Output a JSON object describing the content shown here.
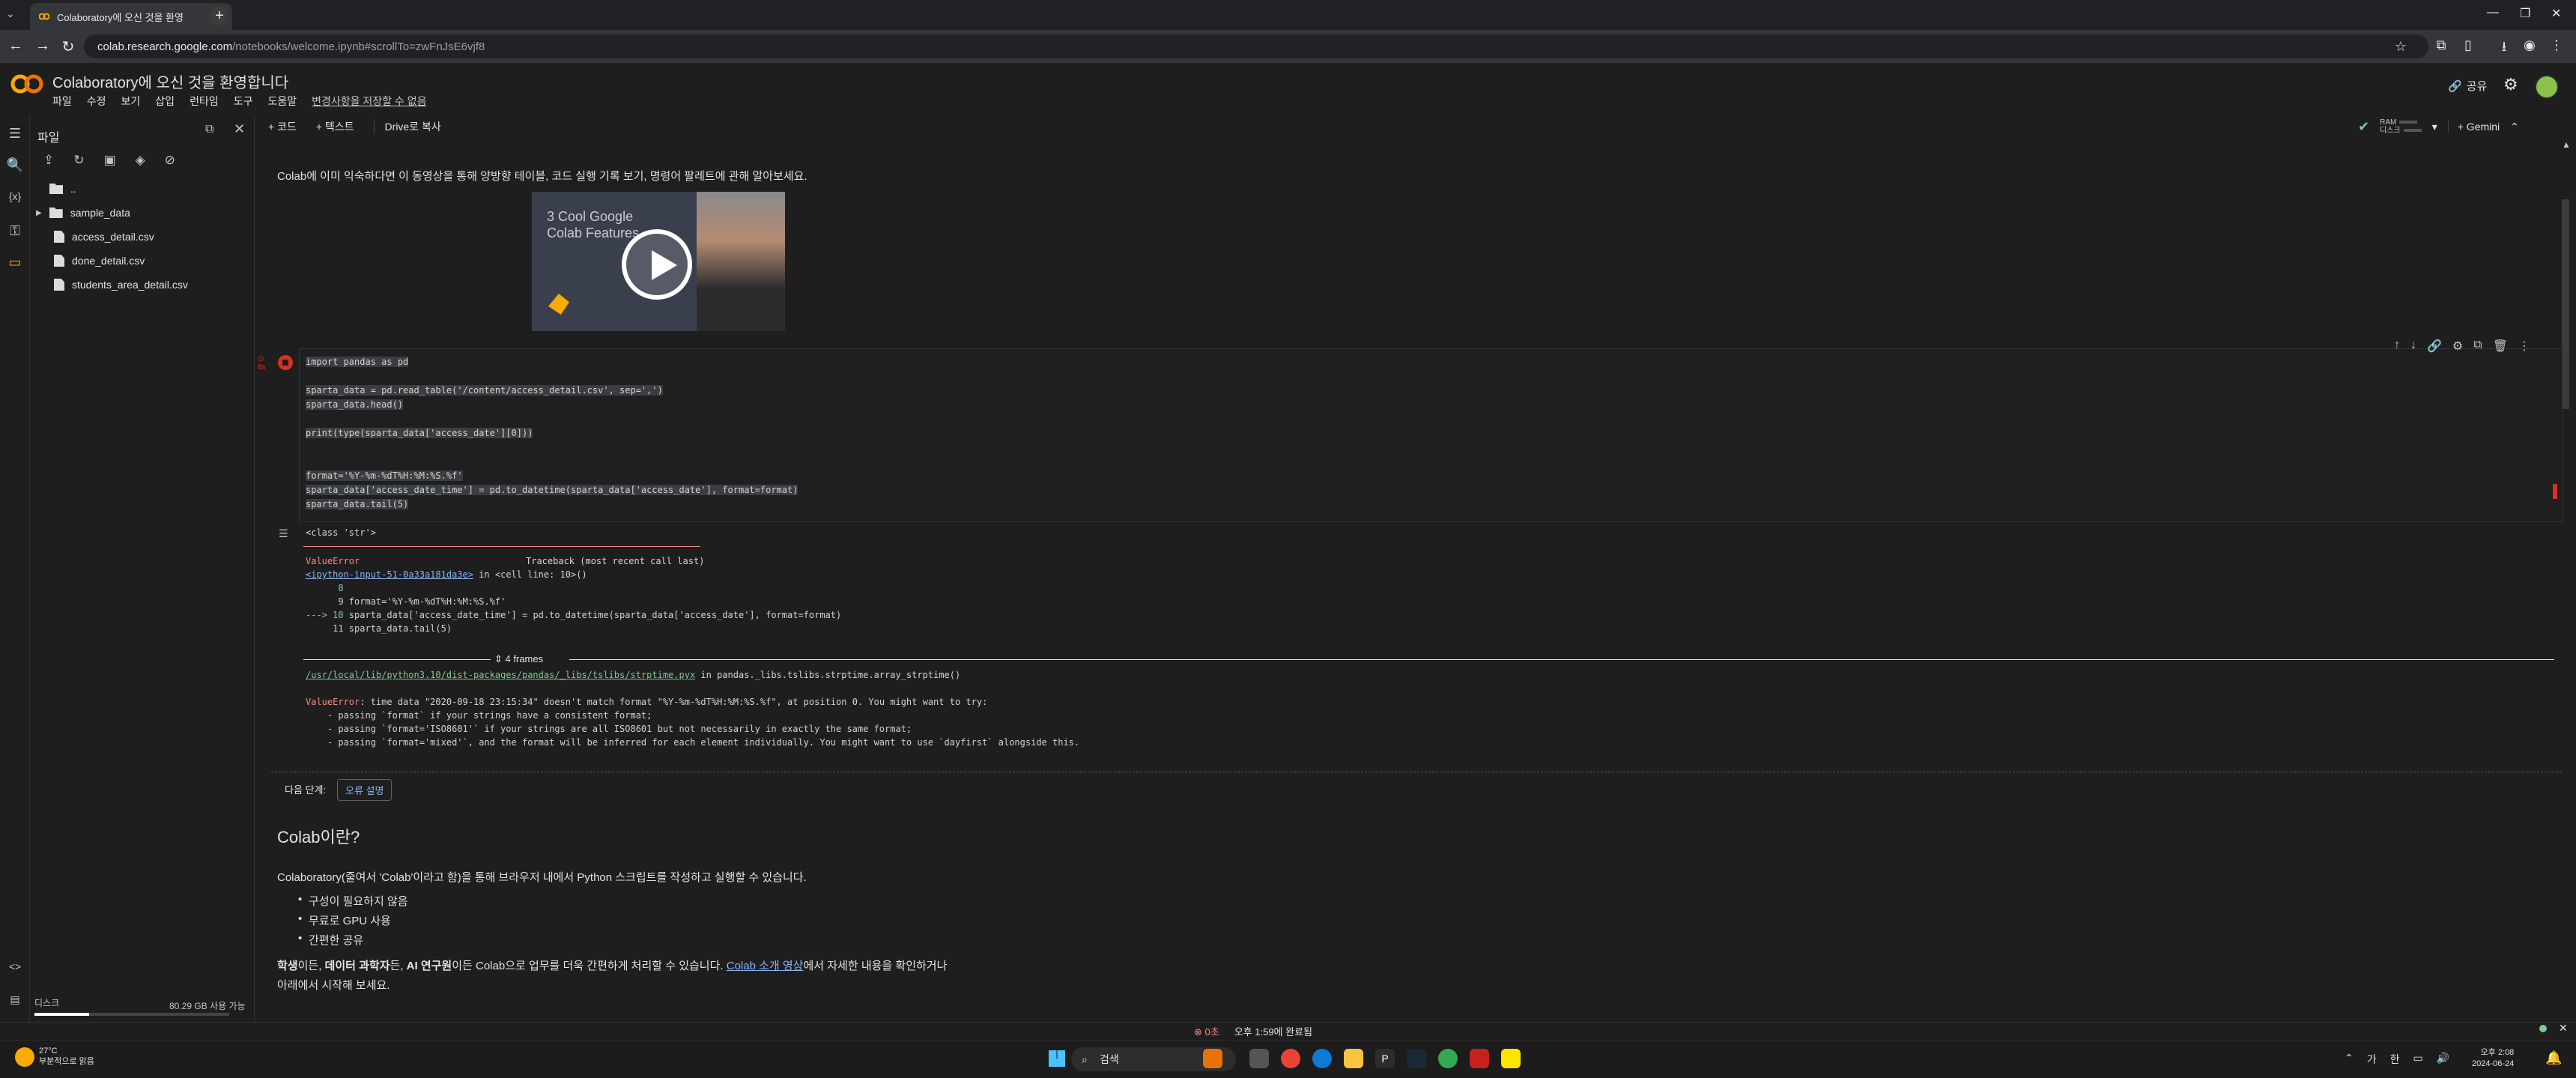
{
  "browser": {
    "tab_title": "Colaboratory에 오신 것을 환영",
    "url_domain": "colab.research.google.com",
    "url_path": "/notebooks/welcome.ipynb#scrollTo=zwFnJsE6vjf8"
  },
  "header": {
    "title": "Colaboratory에 오신 것을 환영합니다",
    "menu": [
      "파일",
      "수정",
      "보기",
      "삽입",
      "런타임",
      "도구",
      "도움말"
    ],
    "unsaved": "변경사항을 저장할 수 없음",
    "share": "공유"
  },
  "toolbar": {
    "add_code": "+ 코드",
    "add_text": "+ 텍스트",
    "drive_copy": "Drive로 복사",
    "ram": "RAM",
    "disk": "디스크",
    "gemini": "+ Gemini"
  },
  "files": {
    "title": "파일",
    "parent": "..",
    "items": [
      {
        "name": "sample_data",
        "type": "folder"
      },
      {
        "name": "access_detail.csv",
        "type": "file"
      },
      {
        "name": "done_detail.csv",
        "type": "file"
      },
      {
        "name": "students_area_detail.csv",
        "type": "file"
      }
    ],
    "disk_label": "디스크",
    "disk_free": "80.29 GB 사용 가능",
    "disk_used_fraction": 0.28
  },
  "notebook": {
    "intro": "Colab에 이미 익숙하다면 이 동영상을 통해 양방향 테이블, 코드 실행 기록 보기, 명령어 팔레트에 관해 알아보세요.",
    "video_title_1": "3 Cool Google",
    "video_title_2": "Colab Features",
    "exec_count": "8s",
    "code_lines": [
      "import pandas as pd",
      "",
      "sparta_data = pd.read_table('/content/access_detail.csv', sep=',')",
      "sparta_data.head()",
      "",
      "print(type(sparta_data['access_date'][0]))",
      "",
      "",
      "format='%Y-%m-%dT%H:%M:%S.%f'",
      "sparta_data['access_date_time'] = pd.to_datetime(sparta_data['access_date'], format=format)",
      "sparta_data.tail(5)"
    ],
    "output": {
      "class_line": "<class 'str'>",
      "err_name": "ValueError",
      "traceback_label": "Traceback (most recent call last)",
      "cell_link": "<ipython-input-51-0a33a181da3e>",
      "cell_link_suffix": " in <cell line: 10>()",
      "tb_line_8": "      8",
      "tb_line_9": "      9 format='%Y-%m-%dT%H:%M:%S.%f'",
      "tb_line_10_arrow": "---> 10",
      "tb_line_10": " sparta_data['access_date_time'] = pd.to_datetime(sparta_data['access_date'], format=format)",
      "tb_line_11": "     11 sparta_data.tail(5)",
      "frames": "4 frames",
      "strptime_link": "/usr/local/lib/python3.10/dist-packages/pandas/_libs/tslibs/strptime.pyx",
      "strptime_suffix": " in pandas._libs.tslibs.strptime.array_strptime()",
      "err_msg_name": "ValueError",
      "err_msg": ": time data \"2020-09-18 23:15:34\" doesn't match format \"%Y-%m-%dT%H:%M:%S.%f\", at position 0. You might want to try:",
      "hint1": "    - passing `format` if your strings have a consistent format;",
      "hint2": "    - passing `format='ISO8601'` if your strings are all ISO8601 but not necessarily in exactly the same format;",
      "hint3": "    - passing `format='mixed'`, and the format will be inferred for each element individually. You might want to use `dayfirst` alongside this."
    },
    "next_step": "다음 단계:",
    "explain_error": "오류 설명",
    "h2": "Colab이란?",
    "para1": "Colaboratory(줄여서 'Colab'이라고 함)을 통해 브라우저 내에서 Python 스크립트를 작성하고 실행할 수 있습니다.",
    "bullets": [
      "구성이 필요하지 않음",
      "무료로 GPU 사용",
      "간편한 공유"
    ],
    "para2_a": "학생",
    "para2_b": "이든, ",
    "para2_c": "데이터 과학자",
    "para2_d": "든, ",
    "para2_e": "AI 연구원",
    "para2_f": "이든 Colab으로 업무를 더욱 간편하게 처리할 수 있습니다. ",
    "para2_link": "Colab 소개 영상",
    "para2_g": "에서 자세한 내용을 확인하거나",
    "para3": "아래에서 시작해 보세요."
  },
  "statusbar": {
    "elapsed": "0초",
    "completed": "오후 1:59에 완료됨"
  },
  "taskbar": {
    "temp": "27°C",
    "weather": "부분적으로 맑음",
    "search": "검색",
    "ime1": "가",
    "ime2": "한",
    "time": "오후 2:08",
    "date": "2024-06-24"
  }
}
